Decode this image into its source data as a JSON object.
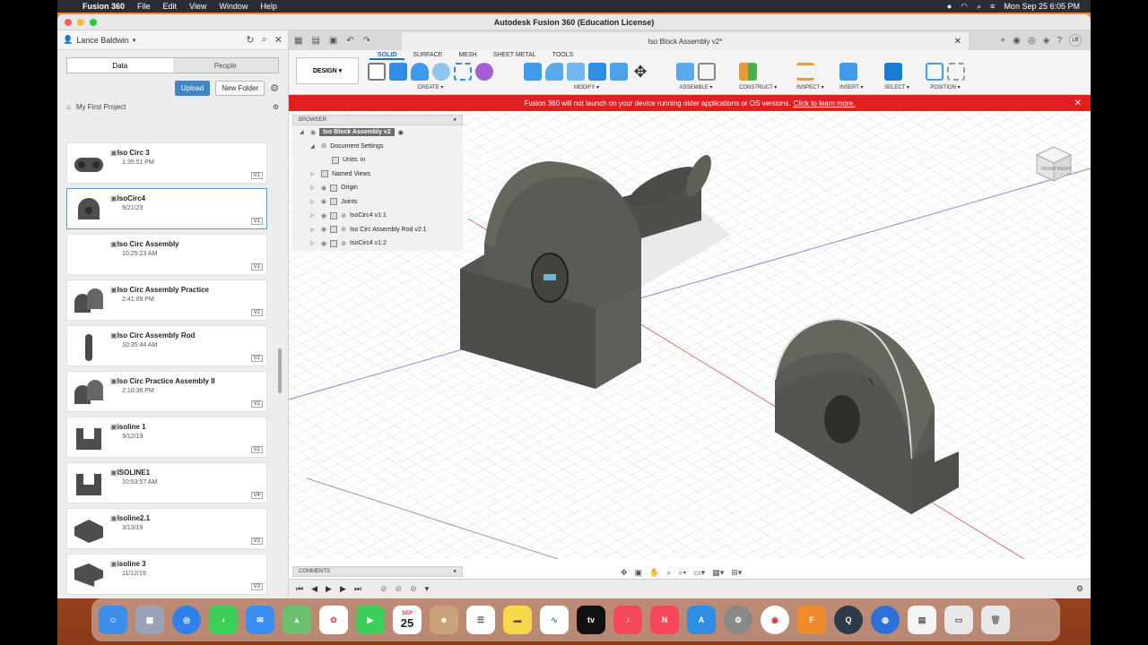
{
  "menubar": {
    "app": "Fusion 360",
    "items": [
      "File",
      "Edit",
      "View",
      "Window",
      "Help"
    ],
    "clock": "Mon Sep 25  6:05 PM"
  },
  "window": {
    "title": "Autodesk Fusion 360 (Education License)"
  },
  "data_panel": {
    "user": "Lance Baldwin",
    "tabs": [
      "Data",
      "People"
    ],
    "upload": "Upload",
    "new_folder": "New Folder",
    "project": "My First Project",
    "files": [
      {
        "name": "Iso Circ 3",
        "date": "1:35:51 PM",
        "version": "V1"
      },
      {
        "name": "IsoCirc4",
        "date": "9/21/23",
        "version": "V1"
      },
      {
        "name": "Iso Circ Assembly",
        "date": "10:25:23 AM",
        "version": "V1"
      },
      {
        "name": "Iso Circ Assembly Practice",
        "date": "2:41:09 PM",
        "version": "V2"
      },
      {
        "name": "Iso Circ Assembly Rod",
        "date": "10:35:44 AM",
        "version": "V2"
      },
      {
        "name": "Iso Circ Practice Assembly II",
        "date": "2:10:36 PM",
        "version": "V2"
      },
      {
        "name": "isoline 1",
        "date": "3/12/19",
        "version": "V2"
      },
      {
        "name": "ISOLINE1",
        "date": "10:53:57 AM",
        "version": "V4"
      },
      {
        "name": "Isoline2.1",
        "date": "3/13/19",
        "version": "V2"
      },
      {
        "name": "isoline 3",
        "date": "11/12/19",
        "version": "V3"
      }
    ]
  },
  "doc_tab": {
    "title": "Iso Block Assembly v2*"
  },
  "toolbar": {
    "design": "DESIGN ▾",
    "workspaces": [
      "SOLID",
      "SURFACE",
      "MESH",
      "SHEET METAL",
      "TOOLS"
    ],
    "groups": [
      "CREATE ▾",
      "MODIFY ▾",
      "ASSEMBLE ▾",
      "CONSTRUCT ▾",
      "INSPECT ▾",
      "INSERT ▾",
      "SELECT ▾",
      "POSITION ▾"
    ]
  },
  "banner": {
    "text": "Fusion 360 will not launch on your device running older applications or OS versions.",
    "link": "Click to learn more."
  },
  "browser": {
    "header": "BROWSER",
    "root": "Iso Block Assembly v2",
    "items": [
      "Document Settings",
      "Units: in",
      "Named Views",
      "Origin",
      "Joints",
      "IsoCirc4 v1:1",
      "Iso Circ Assembly Rod v2:1",
      "IsoCirc4 v1:2"
    ]
  },
  "comments": {
    "header": "COMMENTS"
  },
  "viewcube": {
    "top": "FRONT",
    "right": "RIGHT"
  },
  "dock": {
    "calendar_month": "SEP",
    "calendar_day": "25"
  },
  "colors": {
    "accent": "#1a6bc0",
    "banner": "#e0201f",
    "part": "#5a5a55"
  }
}
